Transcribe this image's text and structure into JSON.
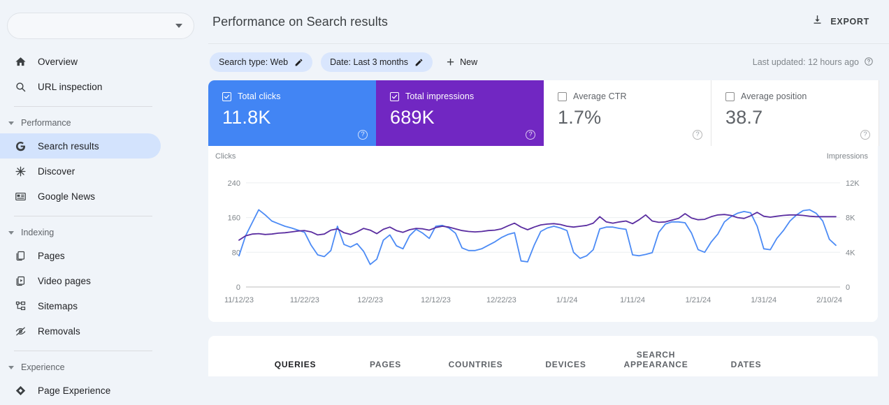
{
  "sidebar": {
    "property_selector": {
      "value": "",
      "icon": "chevron-down-icon"
    },
    "items": [
      {
        "label": "Overview",
        "icon": "home-icon",
        "active": false
      },
      {
        "label": "URL inspection",
        "icon": "search-icon",
        "active": false
      }
    ],
    "sections": [
      {
        "title": "Performance",
        "items": [
          {
            "label": "Search results",
            "icon": "google-g-icon",
            "active": true
          },
          {
            "label": "Discover",
            "icon": "discover-asterisk-icon",
            "active": false
          },
          {
            "label": "Google News",
            "icon": "google-news-icon",
            "active": false
          }
        ]
      },
      {
        "title": "Indexing",
        "items": [
          {
            "label": "Pages",
            "icon": "pages-icon",
            "active": false
          },
          {
            "label": "Video pages",
            "icon": "video-pages-icon",
            "active": false
          },
          {
            "label": "Sitemaps",
            "icon": "sitemaps-icon",
            "active": false
          },
          {
            "label": "Removals",
            "icon": "removals-eye-off-icon",
            "active": false
          }
        ]
      },
      {
        "title": "Experience",
        "items": [
          {
            "label": "Page Experience",
            "icon": "page-experience-icon",
            "active": false
          }
        ]
      }
    ]
  },
  "header": {
    "title": "Performance on Search results",
    "export_label": "EXPORT",
    "export_icon": "download-icon"
  },
  "filters": {
    "chips": [
      {
        "label": "Search type: Web",
        "icon": "pencil-icon"
      },
      {
        "label": "Date: Last 3 months",
        "icon": "pencil-icon"
      }
    ],
    "new_label": "New",
    "new_icon": "plus-icon",
    "last_updated": "Last updated: 12 hours ago",
    "help_icon": "help-circle-icon"
  },
  "metrics": [
    {
      "name": "Total clicks",
      "value": "11.8K",
      "checked": true,
      "color": "#4285f4",
      "help_icon": "help-circle-icon"
    },
    {
      "name": "Total impressions",
      "value": "689K",
      "checked": true,
      "color": "#7127c2",
      "help_icon": "help-circle-icon"
    },
    {
      "name": "Average CTR",
      "value": "1.7%",
      "checked": false,
      "color": "#ffffff",
      "help_icon": "help-circle-icon"
    },
    {
      "name": "Average position",
      "value": "38.7",
      "checked": false,
      "color": "#ffffff",
      "help_icon": "help-circle-icon"
    }
  ],
  "tabs": [
    {
      "label": "QUERIES",
      "active": true
    },
    {
      "label": "PAGES",
      "active": false
    },
    {
      "label": "COUNTRIES",
      "active": false
    },
    {
      "label": "DEVICES",
      "active": false
    },
    {
      "label": "SEARCH APPEARANCE",
      "active": false
    },
    {
      "label": "DATES",
      "active": false
    }
  ],
  "chart_data": {
    "type": "line",
    "title": "",
    "xlabel": "",
    "left_axis": {
      "label": "Clicks",
      "ticks": [
        "240",
        "160",
        "80",
        "0"
      ],
      "tick_values": [
        240,
        160,
        80,
        0
      ],
      "ylim": [
        0,
        280
      ]
    },
    "right_axis": {
      "label": "Impressions",
      "ticks": [
        "12K",
        "8K",
        "4K",
        "0"
      ],
      "tick_values": [
        12000,
        8000,
        4000,
        0
      ],
      "ylim": [
        0,
        14000
      ]
    },
    "x_tick_labels": [
      "11/12/23",
      "11/22/23",
      "12/2/23",
      "12/12/23",
      "12/22/23",
      "1/1/24",
      "1/11/24",
      "1/21/24",
      "1/31/24",
      "2/10/24"
    ],
    "x_tick_indices": [
      0,
      10,
      20,
      30,
      40,
      50,
      60,
      70,
      80,
      90
    ],
    "grid": true,
    "legend_position": "none",
    "series": [
      {
        "name": "Clicks",
        "color": "#4c8bf5",
        "axis": "left",
        "values": [
          72,
          118,
          148,
          178,
          166,
          152,
          146,
          140,
          136,
          131,
          126,
          96,
          74,
          70,
          84,
          140,
          98,
          92,
          100,
          82,
          52,
          64,
          108,
          120,
          95,
          88,
          118,
          133,
          124,
          112,
          140,
          142,
          136,
          124,
          90,
          84,
          84,
          88,
          96,
          104,
          114,
          121,
          125,
          60,
          58,
          96,
          128,
          136,
          140,
          136,
          130,
          80,
          66,
          72,
          86,
          134,
          138,
          138,
          135,
          133,
          74,
          72,
          75,
          79,
          126,
          145,
          150,
          150,
          148,
          124,
          86,
          80,
          104,
          122,
          150,
          162,
          170,
          174,
          171,
          140,
          88,
          86,
          112,
          130,
          152,
          166,
          176,
          178,
          170,
          152,
          110,
          96
        ]
      },
      {
        "name": "Impressions",
        "color": "#5a2da0",
        "axis": "right",
        "values": [
          5400,
          5900,
          6100,
          6150,
          6050,
          6100,
          6200,
          6250,
          6350,
          6450,
          6500,
          6350,
          6000,
          6100,
          6550,
          6700,
          6250,
          6050,
          6350,
          6750,
          6550,
          6150,
          6650,
          6900,
          6500,
          6300,
          6600,
          6750,
          6700,
          6550,
          6850,
          7000,
          6900,
          6700,
          6500,
          6400,
          6350,
          6400,
          6500,
          6550,
          6700,
          7050,
          7350,
          6900,
          6600,
          6900,
          7150,
          7250,
          7300,
          7200,
          7000,
          6900,
          7000,
          7100,
          7350,
          8100,
          7500,
          7350,
          7500,
          7600,
          7300,
          7750,
          8300,
          7600,
          7450,
          7500,
          7700,
          7900,
          8450,
          7950,
          7750,
          7800,
          8100,
          8300,
          8350,
          8250,
          8000,
          7900,
          8200,
          8600,
          8150,
          8050,
          8150,
          8250,
          8300,
          8300,
          8250,
          8150,
          8100,
          8100,
          8100,
          8100
        ]
      }
    ]
  }
}
